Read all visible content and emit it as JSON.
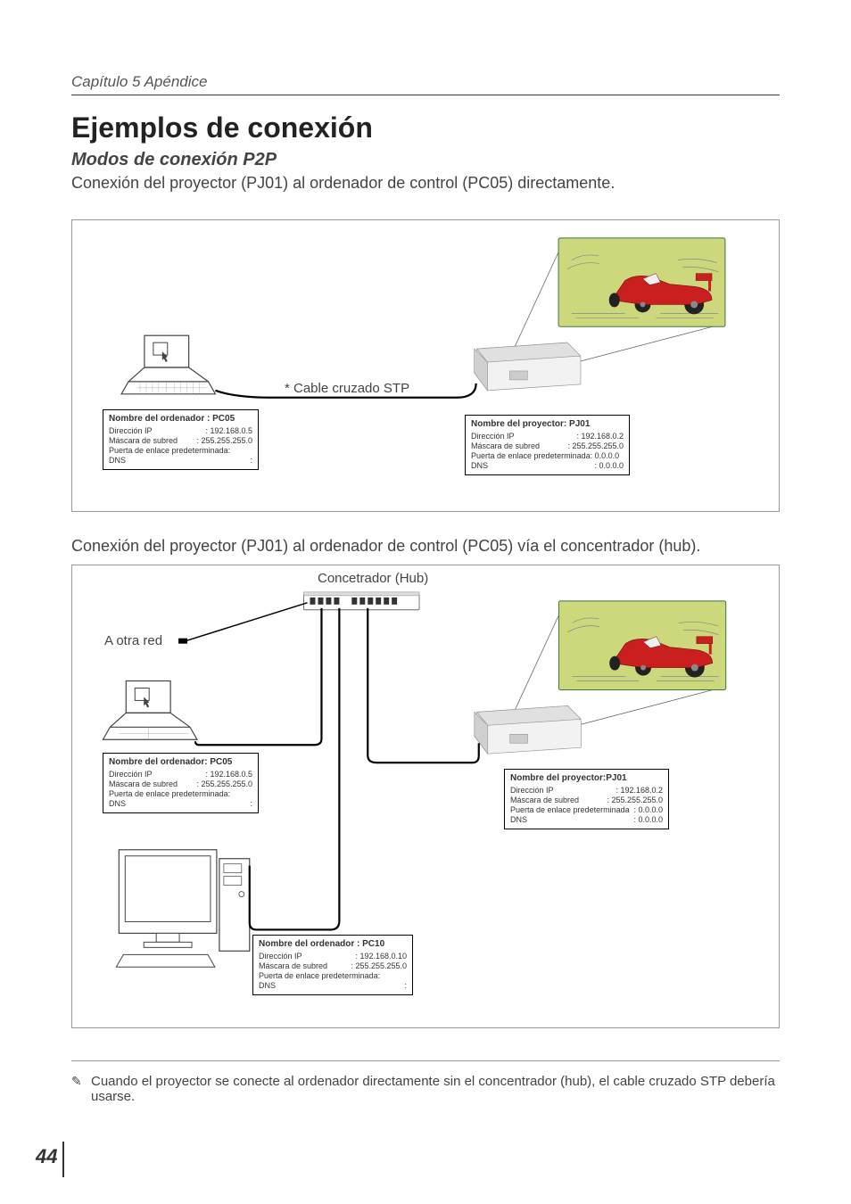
{
  "header": {
    "chapter": "Capítulo 5 Apéndice"
  },
  "title": "Ejemplos de conexión",
  "subtitle": "Modos de conexión P2P",
  "intro1": "Conexión del proyector (PJ01) al ordenador de control (PC05) directamente.",
  "intro2": "Conexión del proyector (PJ01) al ordenador de control (PC05) vía el concentrador (hub).",
  "cable_label": "* Cable cruzado STP",
  "hub_label": "Concetrador (Hub)",
  "other_net": "A otra red",
  "footnote": "Cuando el proyector se conecte al ordenador directamente sin el concentrador (hub), el cable cruzado STP debería usarse.",
  "page_number": "44",
  "box_pc05_a": {
    "title": "Nombre del ordenador : PC05",
    "ip_k": "Dirección IP",
    "ip_v": ": 192.168.0.5",
    "mask_k": "Máscara de subred",
    "mask_v": ": 255.255.255.0",
    "gw_k": "Puerta de enlace predeterminada:",
    "gw_v": "",
    "dns_k": "DNS",
    "dns_v": ":"
  },
  "box_pj01_a": {
    "title": "Nombre del proyector: PJ01",
    "ip_k": "Dirección IP",
    "ip_v": ": 192.168.0.2",
    "mask_k": "Máscara de subred",
    "mask_v": ": 255.255.255.0",
    "gw_k": "Puerta de enlace predeterminada: 0.0.0.0",
    "gw_v": "",
    "dns_k": "DNS",
    "dns_v": ": 0.0.0.0"
  },
  "box_pc05_b": {
    "title": "Nombre del ordenador: PC05",
    "ip_k": "Dirección IP",
    "ip_v": ": 192.168.0.5",
    "mask_k": "Máscara de subred",
    "mask_v": ": 255.255.255.0",
    "gw_k": "Puerta de enlace predeterminada:",
    "gw_v": "",
    "dns_k": "DNS",
    "dns_v": ":"
  },
  "box_pj01_b": {
    "title": "Nombre del proyector:PJ01",
    "ip_k": "Dirección IP",
    "ip_v": ": 192.168.0.2",
    "mask_k": "Máscara de subred",
    "mask_v": ": 255.255.255.0",
    "gw_k": "Puerta de enlace predeterminada",
    "gw_v": ": 0.0.0.0",
    "dns_k": "DNS",
    "dns_v": ": 0.0.0.0"
  },
  "box_pc10": {
    "title": "Nombre del ordenador : PC10",
    "ip_k": "Dirección IP",
    "ip_v": ": 192.168.0.10",
    "mask_k": "Máscara de subred",
    "mask_v": ": 255.255.255.0",
    "gw_k": "Puerta de enlace predeterminada:",
    "gw_v": "",
    "dns_k": "DNS",
    "dns_v": ":"
  }
}
